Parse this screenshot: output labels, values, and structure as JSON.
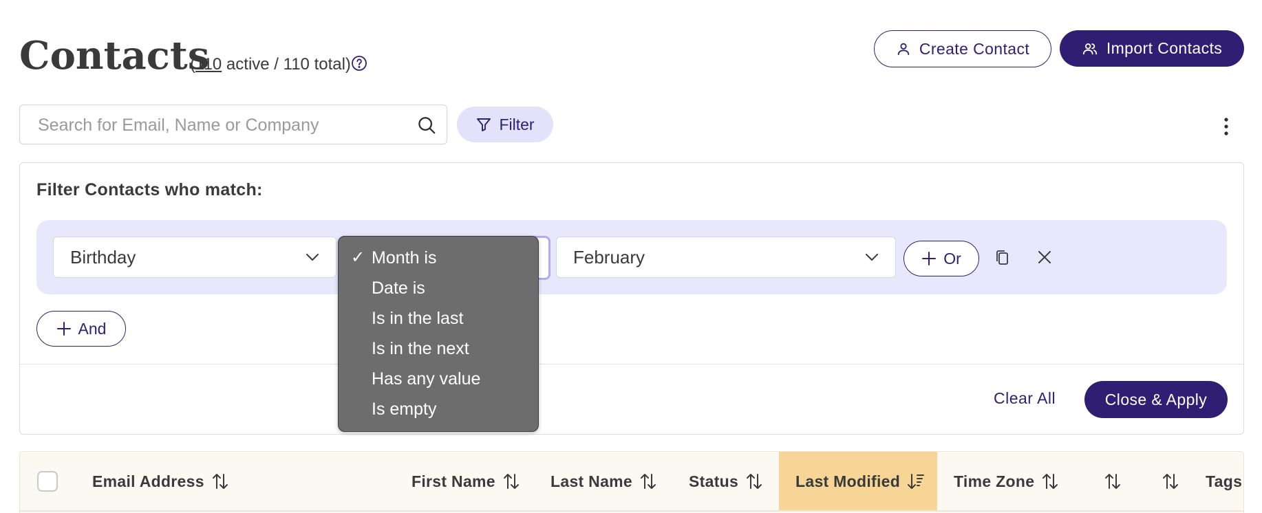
{
  "header": {
    "title": "Contacts",
    "count_open": "(",
    "active_count": "110",
    "count_rest": " active / 110 total)",
    "create_label": "Create Contact",
    "import_label": "Import Contacts"
  },
  "search": {
    "placeholder": "Search for Email, Name or Company",
    "value": "",
    "filter_label": "Filter"
  },
  "filter_panel": {
    "heading": "Filter Contacts who match:",
    "field": "Birthday",
    "operator": "Month is",
    "value": "February",
    "or_label": "Or",
    "and_label": "And",
    "clear_label": "Clear All",
    "apply_label": "Close & Apply"
  },
  "dropdown": {
    "check": "✓",
    "options": [
      "Month is",
      "Date is",
      "Is in the last",
      "Is in the next",
      "Has any value",
      "Is empty"
    ],
    "selected": "Month is"
  },
  "table": {
    "columns": [
      "Email Address",
      "First Name",
      "Last Name",
      "Status",
      "Last Modified",
      "Time Zone",
      "",
      "",
      "Tags"
    ],
    "sorted_column": "Last Modified"
  },
  "colors": {
    "primary": "#2f1f72",
    "filter_row": "#e9e7fb",
    "active_column": "#f6d596",
    "dropdown_bg": "#6d6d6d"
  },
  "icons": [
    "help-icon",
    "user-icon",
    "users-icon",
    "search-icon",
    "funnel-icon",
    "kebab-icon",
    "chevron-down-icon",
    "plus-icon",
    "copy-icon",
    "close-icon",
    "sort-icon",
    "sort-desc-icon"
  ]
}
